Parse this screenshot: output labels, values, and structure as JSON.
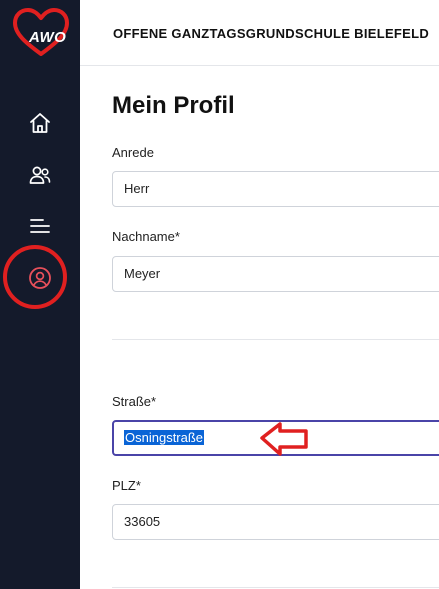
{
  "brand": {
    "logo_text": "AWO",
    "logo_color": "#e02020"
  },
  "sidebar": {
    "background": "#141a2b",
    "items": [
      {
        "name": "home",
        "icon": "home-icon"
      },
      {
        "name": "users",
        "icon": "users-icon"
      },
      {
        "name": "menu",
        "icon": "menu-lines-icon"
      },
      {
        "name": "profile",
        "icon": "user-circle-icon",
        "active": true
      }
    ]
  },
  "header": {
    "title": "OFFENE GANZTAGSGRUNDSCHULE BIELEFELD"
  },
  "page": {
    "title": "Mein Profil"
  },
  "form": {
    "anrede_label": "Anrede",
    "anrede_value": "Herr",
    "nachname_label": "Nachname*",
    "nachname_value": "Meyer",
    "strasse_label": "Straße*",
    "strasse_value": "Osningstraße",
    "plz_label": "PLZ*",
    "plz_value": "33605"
  },
  "annotation": {
    "color": "#e02020"
  }
}
